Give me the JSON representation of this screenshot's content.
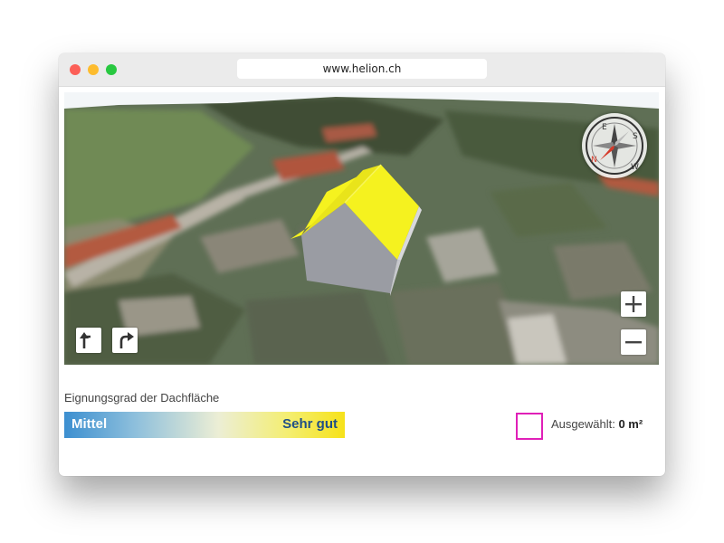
{
  "browser": {
    "url": "www.helion.ch"
  },
  "map": {
    "zoom_in_label": "+",
    "zoom_out_label": "−",
    "compass": {
      "letters": [
        "E",
        "S",
        "W",
        "N"
      ]
    },
    "roof_color": "#f5f21f"
  },
  "legend": {
    "title": "Eignungsgrad der Dachfläche",
    "low_label": "Mittel",
    "high_label": "Sehr gut",
    "gradient_colors": [
      "#3c8fd0",
      "#8dbfdc",
      "#eceed5",
      "#f4ee70",
      "#f6e21a"
    ]
  },
  "selection": {
    "label": "Ausgewählt:",
    "value": "0 m²",
    "box_color": "#e020b8"
  }
}
